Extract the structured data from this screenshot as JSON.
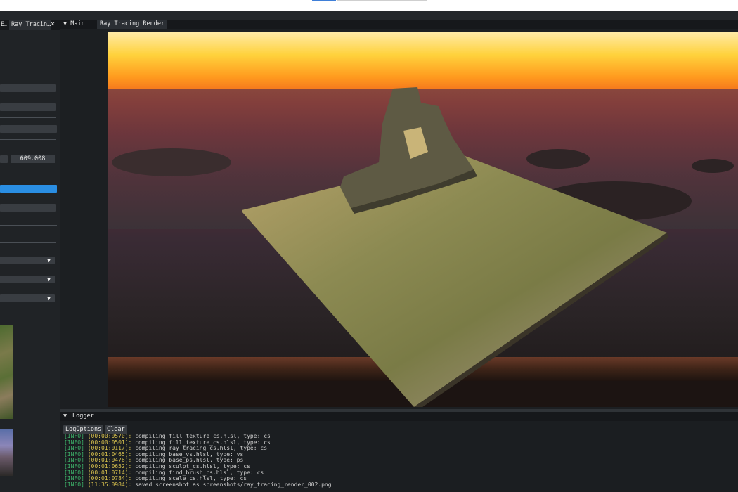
{
  "left_panel": {
    "tabs": [
      {
        "label": "E…"
      },
      {
        "label": "Ray Tracin…"
      }
    ],
    "close_glyph": "×",
    "number_value": "609.008"
  },
  "main_panel": {
    "tab_menu_glyph": "▼",
    "tabs": [
      {
        "label": "Main"
      },
      {
        "label": "Ray Tracing Render"
      }
    ]
  },
  "logger": {
    "title": "Logger",
    "title_glyph": "▼",
    "buttons": {
      "log_options": "LogOptions",
      "clear": "Clear"
    },
    "lines": [
      {
        "level": "[INFO]",
        "time": "(00:00:0570):",
        "msg": " compiling fill_texture_cs.hlsl, type: cs"
      },
      {
        "level": "[INFO]",
        "time": "(00:00:0501):",
        "msg": " compiling fill_texture_cs.hlsl, type: cs"
      },
      {
        "level": "[INFO]",
        "time": "(00:01:0117):",
        "msg": " compiling ray_tracing_cs.hlsl, type: cs"
      },
      {
        "level": "[INFO]",
        "time": "(00:01:0465):",
        "msg": " compiling base_vs.hlsl, type: vs"
      },
      {
        "level": "[INFO]",
        "time": "(00:01:0476):",
        "msg": " compiling base_ps.hlsl, type: ps"
      },
      {
        "level": "[INFO]",
        "time": "(00:01:0652):",
        "msg": " compiling sculpt_cs.hlsl, type: cs"
      },
      {
        "level": "[INFO]",
        "time": "(00:01:0714):",
        "msg": " compiling find_brush_cs.hlsl, type: cs"
      },
      {
        "level": "[INFO]",
        "time": "(00:01:0784):",
        "msg": " compiling scale_cs.hlsl, type: cs"
      },
      {
        "level": "[INFO]",
        "time": "(11:35:0984):",
        "msg": " saved screenshot as screenshots/ray_tracing_render_002.png"
      }
    ]
  },
  "colors": {
    "panel_bg": "#202326",
    "field_bg": "#393d42",
    "accent_blue": "#2a8ee3",
    "log_level": "#3db36a",
    "log_time": "#d9c24e"
  }
}
